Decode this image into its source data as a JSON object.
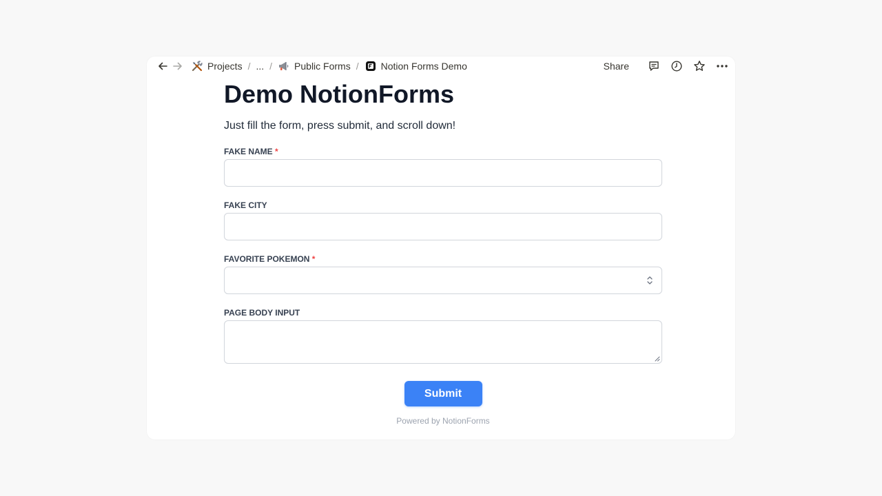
{
  "breadcrumb": {
    "items": [
      {
        "label": "Projects",
        "icon": "tools-icon"
      },
      {
        "label": "..."
      },
      {
        "label": "Public Forms",
        "icon": "megaphone-icon"
      },
      {
        "label": "Notion Forms Demo",
        "icon": "notion-logo-icon"
      }
    ],
    "separator": "/"
  },
  "actions": {
    "share_label": "Share",
    "icons": [
      "comment-icon",
      "history-icon",
      "star-icon",
      "more-icon"
    ]
  },
  "form": {
    "title": "Demo NotionForms",
    "description": "Just fill the form, press submit, and scroll down!",
    "fields": [
      {
        "label": "FAKE NAME",
        "required": "*",
        "type": "text",
        "value": ""
      },
      {
        "label": "FAKE CITY",
        "required": "",
        "type": "text",
        "value": ""
      },
      {
        "label": "FAVORITE POKEMON",
        "required": "*",
        "type": "select",
        "value": ""
      },
      {
        "label": "PAGE BODY INPUT",
        "required": "",
        "type": "textarea",
        "value": ""
      }
    ],
    "submit_label": "Submit",
    "powered_by": "Powered by NotionForms"
  },
  "colors": {
    "accent": "#3b82f6",
    "required": "#ef4444",
    "background": "#f8f8f8"
  }
}
